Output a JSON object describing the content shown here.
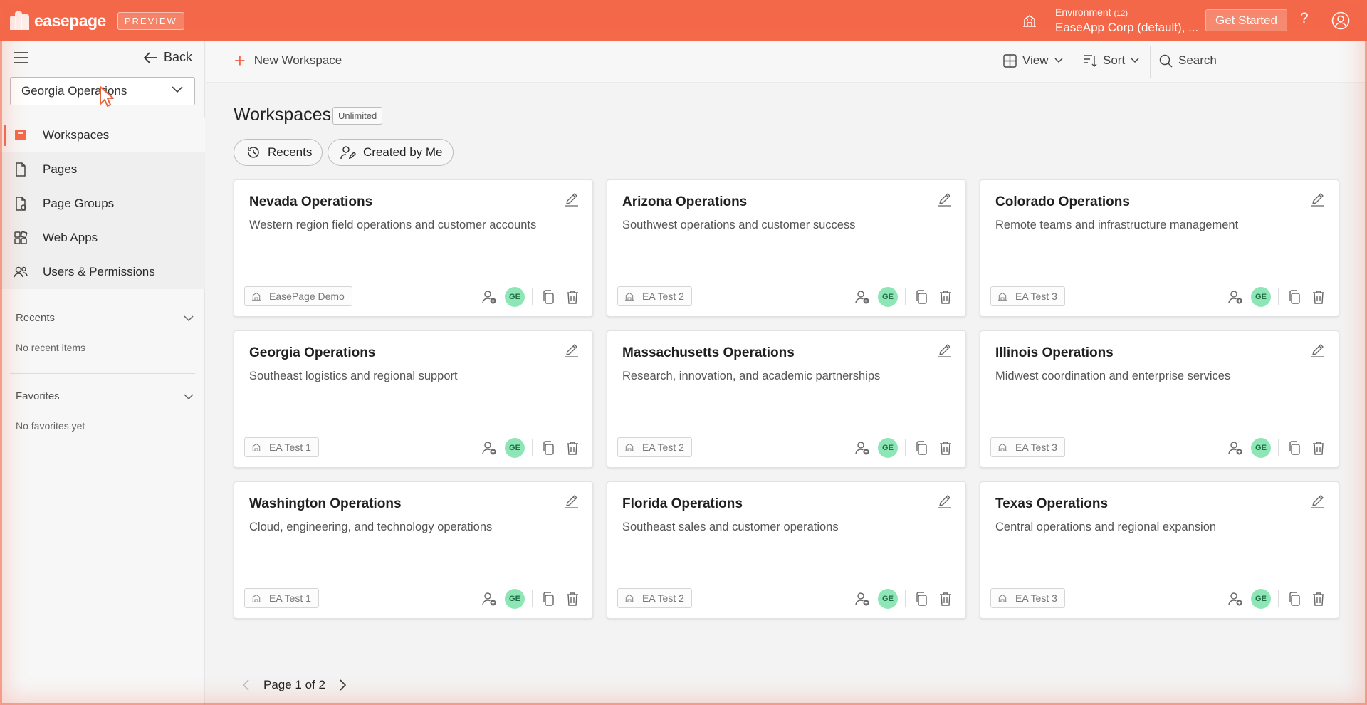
{
  "header": {
    "logo_text": "easepage",
    "preview_badge": "PREVIEW",
    "environment_label": "Environment",
    "environment_count": "(12)",
    "environment_value": "EaseApp Corp (default), ...",
    "get_started": "Get Started",
    "help_glyph": "?",
    "accent_color": "#f4694a"
  },
  "sidebar": {
    "back_label": "Back",
    "workspace_select": "Georgia Operations",
    "items": [
      {
        "label": "Workspaces",
        "icon": "workspace-icon",
        "active": true
      },
      {
        "label": "Pages",
        "icon": "page-icon"
      },
      {
        "label": "Page Groups",
        "icon": "page-groups-icon"
      },
      {
        "label": "Web Apps",
        "icon": "web-apps-icon"
      },
      {
        "label": "Users & Permissions",
        "icon": "users-icon"
      }
    ],
    "recents_title": "Recents",
    "recents_empty": "No recent items",
    "favorites_title": "Favorites",
    "favorites_empty": "No favorites yet"
  },
  "toolbar": {
    "new_workspace": "New Workspace",
    "view": "View",
    "sort": "Sort",
    "search": "Search"
  },
  "main": {
    "title": "Workspaces",
    "limit_badge": "Unlimited",
    "filters": [
      {
        "label": "Recents"
      },
      {
        "label": "Created by Me"
      }
    ],
    "cards": [
      {
        "title": "Nevada Operations",
        "desc": "Western region field operations and customer accounts",
        "env": "EasePage Demo",
        "avatar": "GE"
      },
      {
        "title": "Arizona Operations",
        "desc": "Southwest operations and customer success",
        "env": "EA Test 2",
        "avatar": "GE"
      },
      {
        "title": "Colorado Operations",
        "desc": "Remote teams and infrastructure management",
        "env": "EA Test 3",
        "avatar": "GE"
      },
      {
        "title": "Georgia Operations",
        "desc": "Southeast logistics and regional support",
        "env": "EA Test 1",
        "avatar": "GE"
      },
      {
        "title": "Massachusetts Operations",
        "desc": "Research, innovation, and academic partnerships",
        "env": "EA Test 2",
        "avatar": "GE"
      },
      {
        "title": "Illinois Operations",
        "desc": "Midwest coordination and enterprise services",
        "env": "EA Test 3",
        "avatar": "GE"
      },
      {
        "title": "Washington Operations",
        "desc": "Cloud, engineering, and technology operations",
        "env": "EA Test 1",
        "avatar": "GE"
      },
      {
        "title": "Florida Operations",
        "desc": "Southeast sales and customer operations",
        "env": "EA Test 2",
        "avatar": "GE"
      },
      {
        "title": "Texas Operations",
        "desc": "Central operations and regional expansion",
        "env": "EA Test 3",
        "avatar": "GE"
      }
    ],
    "pagination": "Page 1 of 2"
  }
}
